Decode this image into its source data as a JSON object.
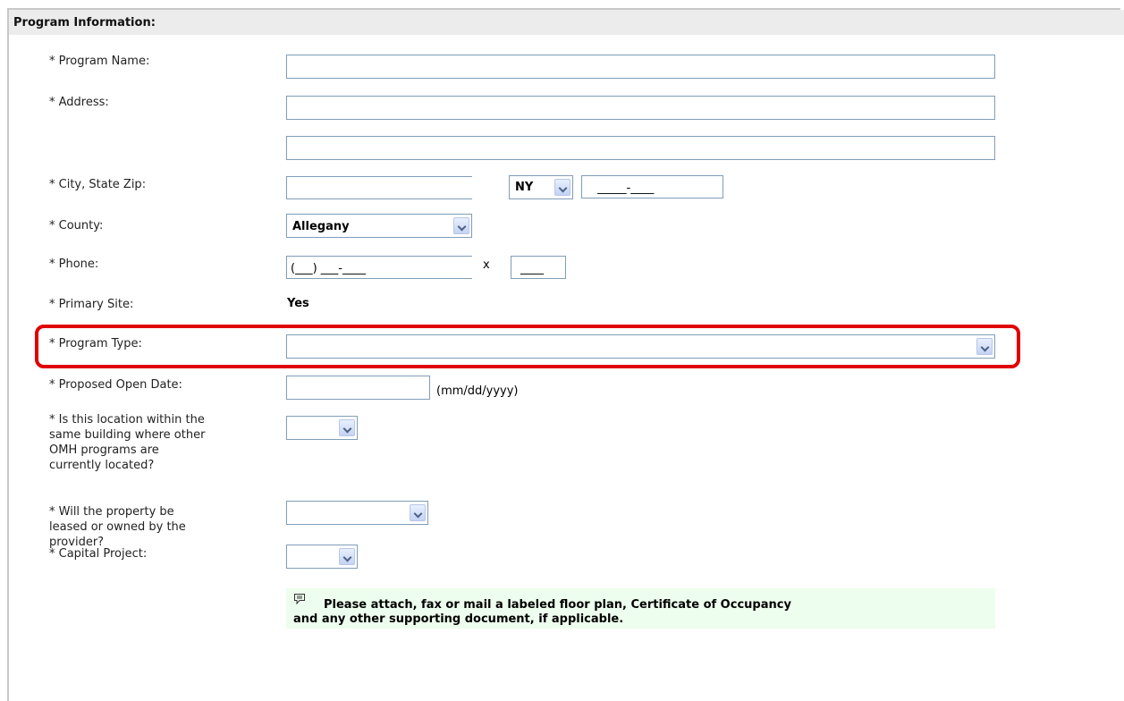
{
  "section": {
    "title": "Program Information:"
  },
  "labels": {
    "program_name": "* Program Name:",
    "address": "* Address:",
    "city_state_zip": "* City, State Zip:",
    "county": "* County:",
    "phone": "* Phone:",
    "primary_site": "* Primary Site:",
    "program_type": "* Program Type:",
    "open_date": "* Proposed Open Date:",
    "same_building": [
      "* Is this location within the",
      "same building where other",
      "OMH programs are",
      "currently located?"
    ],
    "leased_owned": [
      "* Will the property be",
      "leased or owned by the",
      "provider?"
    ],
    "capital_project": "* Capital Project:"
  },
  "fields": {
    "program_name": "",
    "address1": "",
    "address2": "",
    "city": "",
    "state": "NY",
    "zip_mask": "_____-____",
    "county": "Allegany",
    "phone_mask": "(___) ___-____",
    "ext_label": "x",
    "ext_mask": "____",
    "primary_site": "Yes",
    "program_type": "",
    "open_date": "",
    "date_hint": "(mm/dd/yyyy)",
    "same_building": "",
    "leased_owned": "",
    "capital_project": ""
  },
  "note": {
    "line1": "Please attach, fax or mail a labeled floor plan, Certificate of Occupancy",
    "line2": "and any other supporting document, if applicable."
  }
}
